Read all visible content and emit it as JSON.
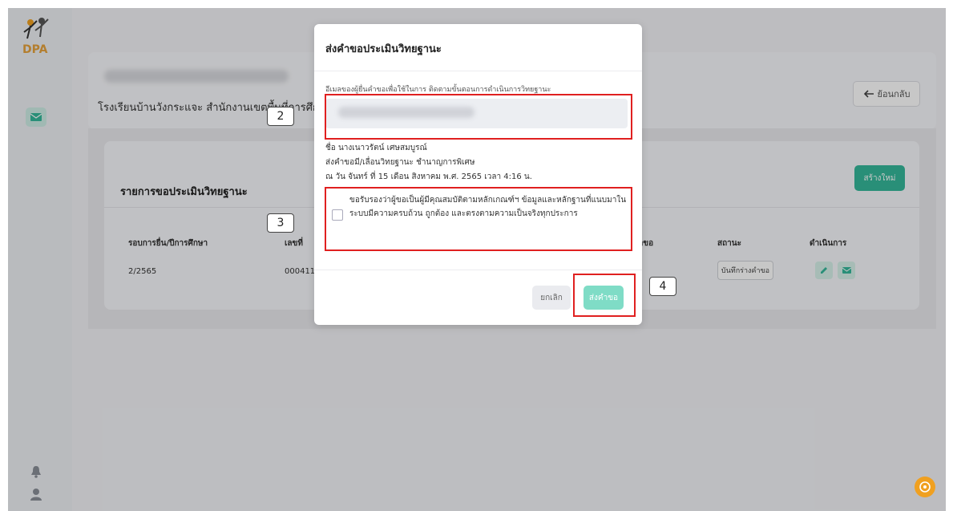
{
  "page": {
    "school_line": "โรงเรียนบ้านวังกระแจะ สำนักงานเขตพื้นที่การศึกษ",
    "back_label": "ย้อนกลับ",
    "list_title": "รายการขอประเมินวิทยฐานะ",
    "create_label": "สร้างใหม่",
    "columns": [
      "รอบการยื่น/ปีการศึกษา",
      "เลขที่",
      "คำขอ",
      "สถานะ",
      "ดำเนินการ"
    ],
    "row": {
      "round": "2/2565",
      "number": "000411",
      "status": "บันทึกร่างคำขอ"
    }
  },
  "modal": {
    "title": "ส่งคำขอประเมินวิทยฐานะ",
    "email_label": "อีเมลของผู้ยื่นคำขอเพื่อใช้ในการ ติดตามขั้นตอนการดำเนินการวิทยฐานะ",
    "name_line": "ชื่อ นางเนาวรัตน์ เศษสมบูรณ์",
    "request_line": "ส่งคำขอมี/เลื่อนวิทยฐานะ ชำนาญการพิเศษ",
    "date_line": "ณ วัน จันทร์ ที่ 15 เดือน สิงหาคม พ.ศ. 2565 เวลา 4:16 น.",
    "certify_text": "ขอรับรองว่าผู้ขอเป็นผู้มีคุณสมบัติตามหลักเกณฑ์ฯ ข้อมูลและหลักฐานที่แนบมาในระบบมีความครบถ้วน ถูกต้อง และตรงตามความเป็นจริงทุกประการ",
    "cancel_label": "ยกเลิก",
    "send_label": "ส่งคำขอ"
  },
  "callouts": [
    "2",
    "3",
    "4"
  ],
  "colors": {
    "accent": "#35b89a",
    "accent_light": "#7fdcc6",
    "highlight": "#e02020",
    "help": "#f0a020"
  },
  "icons": [
    "logo-icon",
    "mail-icon",
    "bell-icon",
    "user-icon",
    "arrow-left-icon",
    "edit-icon",
    "help-icon"
  ]
}
